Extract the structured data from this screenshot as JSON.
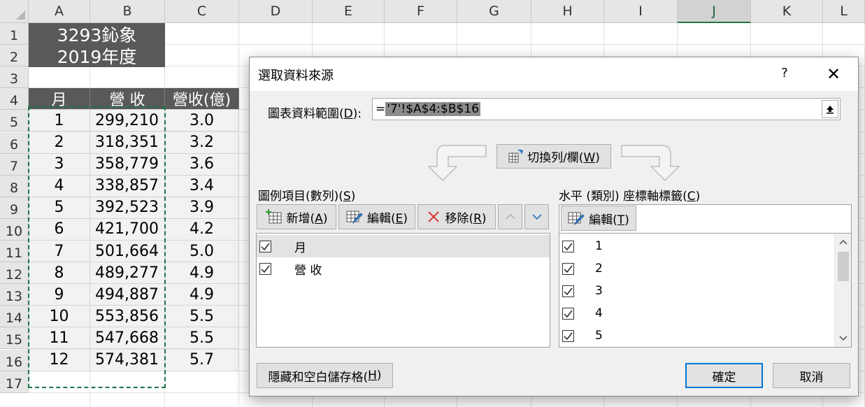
{
  "sheet": {
    "columns": [
      "A",
      "B",
      "C",
      "D",
      "E",
      "F",
      "G",
      "H",
      "I",
      "J",
      "K",
      "L"
    ],
    "active_column": "J",
    "rows": [
      "1",
      "2",
      "3",
      "4",
      "5",
      "6",
      "7",
      "8",
      "9",
      "10",
      "11",
      "12",
      "13",
      "14",
      "15",
      "16",
      "17"
    ],
    "title_line1": "3293鈊象",
    "title_line2": "2019年度",
    "headers": [
      "月",
      "營 收",
      "營收(億)"
    ],
    "data": [
      [
        "1",
        "299,210",
        "3.0"
      ],
      [
        "2",
        "318,351",
        "3.2"
      ],
      [
        "3",
        "358,779",
        "3.6"
      ],
      [
        "4",
        "338,857",
        "3.4"
      ],
      [
        "5",
        "392,523",
        "3.9"
      ],
      [
        "6",
        "421,700",
        "4.2"
      ],
      [
        "7",
        "501,664",
        "5.0"
      ],
      [
        "8",
        "489,277",
        "4.9"
      ],
      [
        "9",
        "494,887",
        "4.9"
      ],
      [
        "10",
        "553,856",
        "5.5"
      ],
      [
        "11",
        "547,668",
        "5.5"
      ],
      [
        "12",
        "574,381",
        "5.7"
      ]
    ]
  },
  "dialog": {
    "title": "選取資料來源",
    "help": "?",
    "close": "✕",
    "range_label_prefix": "圖表資料範圍(",
    "range_label_key": "D",
    "range_label_suffix": "):",
    "range_value_prefix": "=",
    "range_value_selected": "'7'!$A$4:$B$16",
    "switch_prefix": "切換列/欄(",
    "switch_key": "W",
    "switch_suffix": ")",
    "legend_label_prefix": "圖例項目(數列)(",
    "legend_label_key": "S",
    "legend_label_suffix": ")",
    "add_prefix": "新增(",
    "add_key": "A",
    "add_suffix": ")",
    "edit_prefix": "編輯(",
    "edit_key": "E",
    "edit_suffix": ")",
    "remove_prefix": "移除(",
    "remove_key": "R",
    "remove_suffix": ")",
    "series": [
      {
        "label": "月",
        "checked": true,
        "selected": true
      },
      {
        "label": "營 收",
        "checked": true,
        "selected": false
      }
    ],
    "axis_label_prefix": "水平 (類別) 座標軸標籤(",
    "axis_label_key": "C",
    "axis_label_suffix": ")",
    "axis_edit_prefix": "編輯(",
    "axis_edit_key": "T",
    "axis_edit_suffix": ")",
    "categories": [
      "1",
      "2",
      "3",
      "4",
      "5"
    ],
    "hidden_prefix": "隱藏和空白儲存格(",
    "hidden_key": "H",
    "hidden_suffix": ")",
    "ok": "確定",
    "cancel": "取消"
  },
  "colors": {
    "accent": "#0078d7",
    "excel_green": "#217346",
    "header_fill": "#595959"
  }
}
